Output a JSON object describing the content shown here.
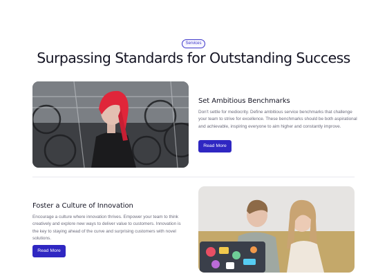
{
  "section": {
    "badge": "Services",
    "heading": "Surpassing Standards for Outstanding Success"
  },
  "features": [
    {
      "title": "Set Ambitious Benchmarks",
      "text": "Don't settle for mediocrity. Define ambitious service benchmarks that challenge your team to strive for excellence. These benchmarks should be both aspirational and achievable, inspiring everyone to aim higher and constantly improve.",
      "button": "Read More",
      "image": "woman-with-red-hair-bike-shop-photo"
    },
    {
      "title": "Foster a Culture of Innovation",
      "text": "Encourage a culture where innovation thrives. Empower your team to think creatively and explore new ways to deliver value to customers. Innovation is the key to staying ahead of the curve and surprising customers with novel solutions.",
      "button": "Read More",
      "image": "two-people-looking-at-laptop-photo"
    }
  ],
  "colors": {
    "accent": "#2f27c2",
    "heading": "#141423",
    "body_text": "#6b6b7b",
    "divider": "#e8e8ee"
  }
}
